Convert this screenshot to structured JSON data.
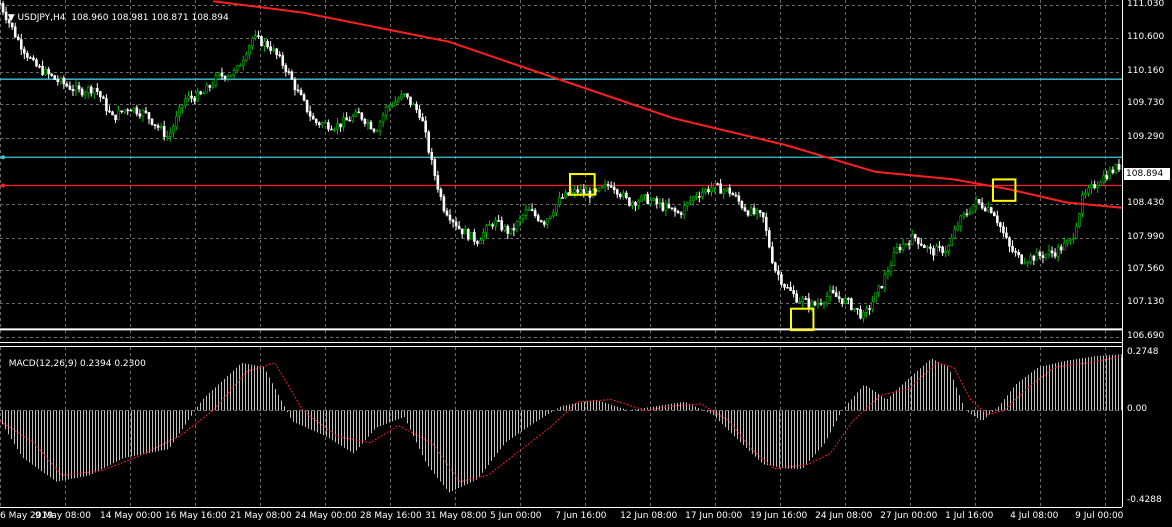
{
  "header": {
    "symbol": "USDJPY,H4",
    "ohlc": "108.960 108.981 108.871 108.894"
  },
  "macd": {
    "title": "MACD(12,26,9)",
    "values": "0.2394 0.2300"
  },
  "price_tag": "108.894",
  "colors": {
    "background": "#000000",
    "grid": "#6b6b6b",
    "bull": "#00c000",
    "bear": "#ffffff",
    "ma": "#ff2020",
    "level": "#3cc8d8",
    "support": "#ffffff",
    "highlight": "#ffff00",
    "macd_hist": "#c0c0c0",
    "macd_signal": "#ff2020"
  },
  "chart_data": [
    {
      "type": "line",
      "name": "main",
      "ylim": [
        106.69,
        111.03
      ],
      "yticks": [
        "111.030",
        "110.600",
        "110.160",
        "109.730",
        "109.290",
        "108.430",
        "107.990",
        "107.560",
        "107.130",
        "106.690"
      ],
      "xticks": [
        "6 May 2019",
        "9 May 08:00",
        "14 May 00:00",
        "16 May 16:00",
        "21 May 08:00",
        "24 May 00:00",
        "28 May 16:00",
        "31 May 08:00",
        "5 Jun 00:00",
        "7 Jun 16:00",
        "12 Jun 08:00",
        "17 Jun 00:00",
        "19 Jun 16:00",
        "24 Jun 08:00",
        "27 Jun 00:00",
        "1 Jul 16:00",
        "4 Jul 08:00",
        "9 Jul 00:00"
      ],
      "price_path": [
        [
          0,
          111.05
        ],
        [
          0.015,
          110.6
        ],
        [
          0.03,
          110.25
        ],
        [
          0.05,
          110.05
        ],
        [
          0.07,
          109.9
        ],
        [
          0.085,
          109.95
        ],
        [
          0.1,
          109.55
        ],
        [
          0.115,
          109.7
        ],
        [
          0.13,
          109.6
        ],
        [
          0.15,
          109.3
        ],
        [
          0.165,
          109.8
        ],
        [
          0.18,
          109.85
        ],
        [
          0.195,
          110.1
        ],
        [
          0.21,
          110.15
        ],
        [
          0.225,
          110.6
        ],
        [
          0.24,
          110.5
        ],
        [
          0.255,
          110.2
        ],
        [
          0.265,
          109.9
        ],
        [
          0.28,
          109.5
        ],
        [
          0.3,
          109.45
        ],
        [
          0.32,
          109.6
        ],
        [
          0.335,
          109.4
        ],
        [
          0.345,
          109.7
        ],
        [
          0.36,
          109.85
        ],
        [
          0.375,
          109.6
        ],
        [
          0.385,
          108.95
        ],
        [
          0.395,
          108.4
        ],
        [
          0.41,
          108.1
        ],
        [
          0.425,
          107.95
        ],
        [
          0.44,
          108.2
        ],
        [
          0.455,
          108.05
        ],
        [
          0.47,
          108.35
        ],
        [
          0.485,
          108.2
        ],
        [
          0.5,
          108.5
        ],
        [
          0.515,
          108.6
        ],
        [
          0.53,
          108.55
        ],
        [
          0.545,
          108.7
        ],
        [
          0.56,
          108.45
        ],
        [
          0.575,
          108.5
        ],
        [
          0.59,
          108.4
        ],
        [
          0.605,
          108.3
        ],
        [
          0.62,
          108.55
        ],
        [
          0.635,
          108.65
        ],
        [
          0.65,
          108.6
        ],
        [
          0.665,
          108.35
        ],
        [
          0.68,
          108.25
        ],
        [
          0.69,
          107.6
        ],
        [
          0.7,
          107.35
        ],
        [
          0.71,
          107.2
        ],
        [
          0.725,
          107.1
        ],
        [
          0.74,
          107.25
        ],
        [
          0.755,
          107.15
        ],
        [
          0.77,
          106.95
        ],
        [
          0.785,
          107.35
        ],
        [
          0.8,
          107.85
        ],
        [
          0.815,
          108.0
        ],
        [
          0.83,
          107.8
        ],
        [
          0.845,
          107.85
        ],
        [
          0.855,
          108.2
        ],
        [
          0.87,
          108.45
        ],
        [
          0.885,
          108.35
        ],
        [
          0.9,
          107.85
        ],
        [
          0.91,
          107.7
        ],
        [
          0.925,
          107.75
        ],
        [
          0.94,
          107.8
        ],
        [
          0.955,
          107.95
        ],
        [
          0.965,
          108.5
        ],
        [
          0.98,
          108.75
        ],
        [
          1.0,
          108.95
        ]
      ],
      "ma_path": [
        [
          0.19,
          111.08
        ],
        [
          0.27,
          110.93
        ],
        [
          0.4,
          110.55
        ],
        [
          0.5,
          110.05
        ],
        [
          0.6,
          109.55
        ],
        [
          0.7,
          109.2
        ],
        [
          0.78,
          108.85
        ],
        [
          0.85,
          108.75
        ],
        [
          0.9,
          108.62
        ],
        [
          0.95,
          108.45
        ],
        [
          1.0,
          108.38
        ]
      ],
      "levels": [
        110.06,
        109.04,
        108.67,
        106.79
      ],
      "highlight_boxes": [
        {
          "x_start": 0.508,
          "x_end": 0.53,
          "y_low": 108.55,
          "y_high": 108.82
        },
        {
          "x_start": 0.705,
          "x_end": 0.725,
          "y_low": 106.78,
          "y_high": 107.06
        },
        {
          "x_start": 0.885,
          "x_end": 0.905,
          "y_low": 108.47,
          "y_high": 108.75
        }
      ]
    },
    {
      "type": "bar",
      "name": "MACD(12,26,9)",
      "ylim": [
        -0.4288,
        0.2748
      ],
      "yticks": [
        "0.2748",
        "0.00",
        "-0.4288"
      ],
      "macd_path": [
        [
          0,
          -0.05
        ],
        [
          0.02,
          -0.22
        ],
        [
          0.05,
          -0.33
        ],
        [
          0.08,
          -0.3
        ],
        [
          0.11,
          -0.22
        ],
        [
          0.15,
          -0.18
        ],
        [
          0.18,
          0.05
        ],
        [
          0.215,
          0.22
        ],
        [
          0.235,
          0.2
        ],
        [
          0.26,
          -0.05
        ],
        [
          0.29,
          -0.12
        ],
        [
          0.315,
          -0.2
        ],
        [
          0.335,
          -0.08
        ],
        [
          0.36,
          -0.03
        ],
        [
          0.38,
          -0.25
        ],
        [
          0.4,
          -0.38
        ],
        [
          0.425,
          -0.32
        ],
        [
          0.45,
          -0.15
        ],
        [
          0.475,
          -0.06
        ],
        [
          0.5,
          0.02
        ],
        [
          0.53,
          0.05
        ],
        [
          0.56,
          0.0
        ],
        [
          0.585,
          0.02
        ],
        [
          0.61,
          0.04
        ],
        [
          0.635,
          -0.02
        ],
        [
          0.66,
          -0.15
        ],
        [
          0.68,
          -0.25
        ],
        [
          0.7,
          -0.27
        ],
        [
          0.715,
          -0.27
        ],
        [
          0.735,
          -0.15
        ],
        [
          0.75,
          0.0
        ],
        [
          0.77,
          0.12
        ],
        [
          0.79,
          0.05
        ],
        [
          0.81,
          0.15
        ],
        [
          0.83,
          0.24
        ],
        [
          0.845,
          0.2
        ],
        [
          0.86,
          0.0
        ],
        [
          0.875,
          -0.05
        ],
        [
          0.89,
          0.02
        ],
        [
          0.905,
          0.12
        ],
        [
          0.925,
          0.2
        ],
        [
          0.95,
          0.23
        ],
        [
          0.975,
          0.25
        ],
        [
          1.0,
          0.26
        ]
      ],
      "signal_path": [
        [
          0,
          -0.05
        ],
        [
          0.03,
          -0.15
        ],
        [
          0.055,
          -0.3
        ],
        [
          0.09,
          -0.28
        ],
        [
          0.12,
          -0.22
        ],
        [
          0.16,
          -0.12
        ],
        [
          0.19,
          0.0
        ],
        [
          0.22,
          0.18
        ],
        [
          0.245,
          0.22
        ],
        [
          0.27,
          0.0
        ],
        [
          0.3,
          -0.12
        ],
        [
          0.33,
          -0.15
        ],
        [
          0.355,
          -0.07
        ],
        [
          0.385,
          -0.15
        ],
        [
          0.41,
          -0.33
        ],
        [
          0.435,
          -0.3
        ],
        [
          0.46,
          -0.2
        ],
        [
          0.49,
          -0.08
        ],
        [
          0.515,
          0.04
        ],
        [
          0.545,
          0.05
        ],
        [
          0.575,
          0.0
        ],
        [
          0.6,
          0.02
        ],
        [
          0.625,
          0.03
        ],
        [
          0.65,
          -0.05
        ],
        [
          0.67,
          -0.18
        ],
        [
          0.69,
          -0.27
        ],
        [
          0.72,
          -0.25
        ],
        [
          0.74,
          -0.2
        ],
        [
          0.76,
          -0.05
        ],
        [
          0.785,
          0.07
        ],
        [
          0.81,
          0.1
        ],
        [
          0.835,
          0.22
        ],
        [
          0.85,
          0.2
        ],
        [
          0.865,
          0.05
        ],
        [
          0.88,
          -0.02
        ],
        [
          0.895,
          0.0
        ],
        [
          0.915,
          0.1
        ],
        [
          0.94,
          0.2
        ],
        [
          0.97,
          0.22
        ],
        [
          1.0,
          0.25
        ]
      ]
    }
  ]
}
